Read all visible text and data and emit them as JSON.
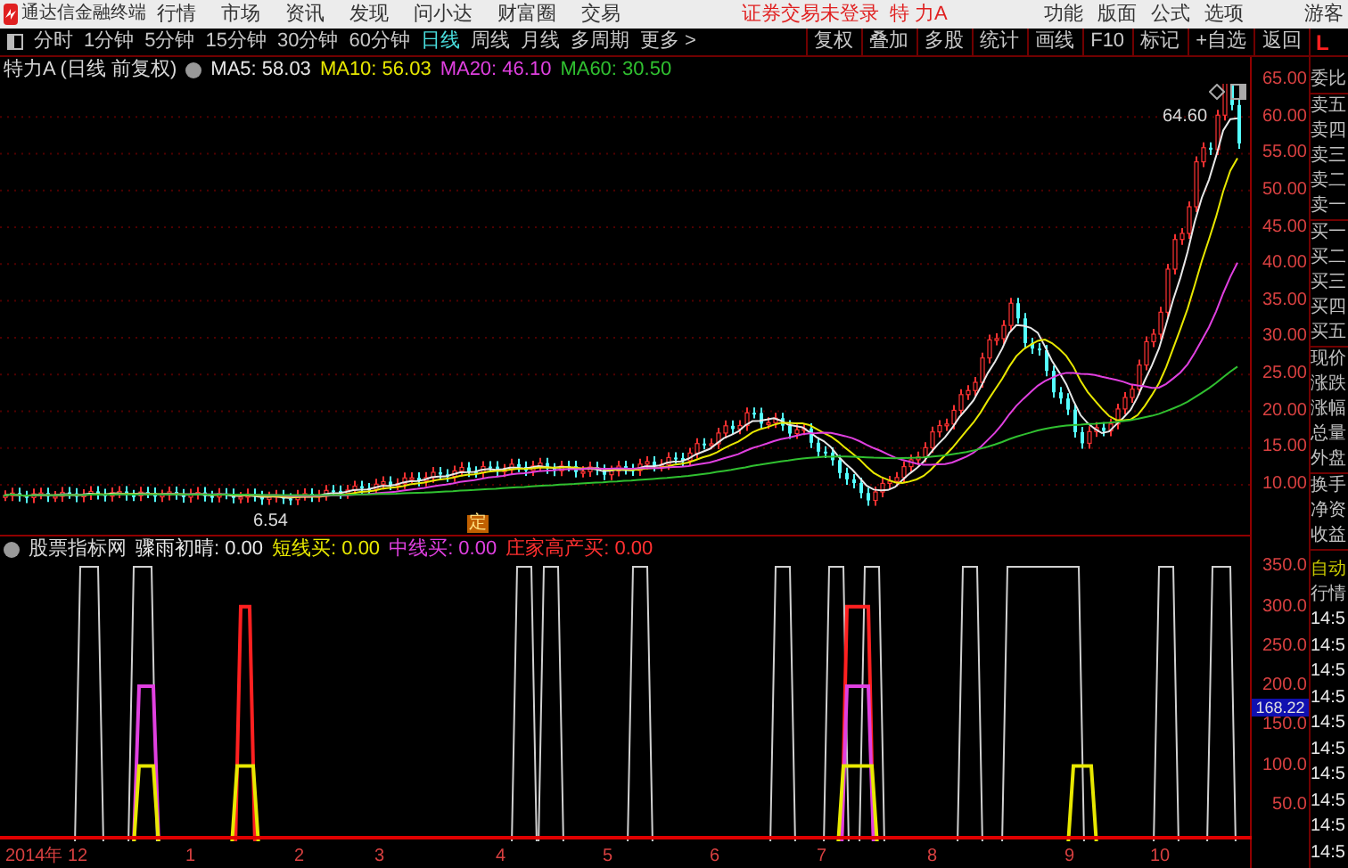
{
  "menu_bar": {
    "app_title": "通达信金融终端",
    "menus": [
      "行情",
      "市场",
      "资讯",
      "发现",
      "问小达",
      "财富圈",
      "交易"
    ],
    "status": "证券交易未登录",
    "stock": "特 力A",
    "actions": [
      "功能",
      "版面",
      "公式",
      "选项"
    ],
    "user": "游客"
  },
  "period_bar": {
    "periods": [
      {
        "label": "分时",
        "selected": false
      },
      {
        "label": "1分钟",
        "selected": false
      },
      {
        "label": "5分钟",
        "selected": false
      },
      {
        "label": "15分钟",
        "selected": false
      },
      {
        "label": "30分钟",
        "selected": false
      },
      {
        "label": "60分钟",
        "selected": false
      },
      {
        "label": "日线",
        "selected": true
      },
      {
        "label": "周线",
        "selected": false
      },
      {
        "label": "月线",
        "selected": false
      },
      {
        "label": "多周期",
        "selected": false
      },
      {
        "label": "更多 >",
        "selected": false
      }
    ],
    "tools": [
      "复权",
      "叠加",
      "多股",
      "统计",
      "画线",
      "F10",
      "标记",
      "+自选",
      "返回"
    ],
    "logo": "L"
  },
  "chart_header": {
    "title": "特力A (日线 前复权)",
    "indicators": [
      {
        "label": "MA5: 58.03",
        "color": "#e8e8e8"
      },
      {
        "label": "MA10: 56.03",
        "color": "#e8e800"
      },
      {
        "label": "MA20: 46.10",
        "color": "#e040e0"
      },
      {
        "label": "MA60: 30.50",
        "color": "#30c030"
      }
    ]
  },
  "price_chart": {
    "axis_labels": [
      "65.00",
      "60.00",
      "55.00",
      "50.00",
      "45.00",
      "40.00",
      "35.00",
      "30.00",
      "25.00",
      "20.00",
      "15.00",
      "10.00"
    ],
    "high_label": "64.60",
    "low_label": "6.54",
    "marker": "定"
  },
  "indicator_header": {
    "title": "股票指标网",
    "values": [
      {
        "label": "骤雨初晴: 0.00",
        "color": "#e8e8e8"
      },
      {
        "label": "短线买: 0.00",
        "color": "#e8e800"
      },
      {
        "label": "中线买: 0.00",
        "color": "#e040e0"
      },
      {
        "label": "庄家高产买: 0.00",
        "color": "#ff3030"
      }
    ]
  },
  "indicator_chart": {
    "axis_labels": [
      "350.0",
      "300.0",
      "250.0",
      "200.0",
      "150.0",
      "100.0",
      "50.0"
    ],
    "cursor_value": "168.22"
  },
  "date_axis": [
    "2014年",
    "12",
    "1",
    "2",
    "3",
    "4",
    "5",
    "6",
    "7",
    "8",
    "9",
    "10"
  ],
  "quote_panel": {
    "groups": [
      [
        "委比"
      ],
      [
        "卖五",
        "卖四",
        "卖三",
        "卖二",
        "卖一"
      ],
      [
        "买一",
        "买二",
        "买三",
        "买四",
        "买五"
      ],
      [
        "现价",
        "涨跌",
        "涨幅",
        "总量",
        "外盘"
      ],
      [
        "换手",
        "净资",
        "收益"
      ]
    ],
    "mode": "自动",
    "title": "行情",
    "times": [
      "14:5",
      "14:5",
      "14:5",
      "14:5",
      "14:5",
      "14:5",
      "14:5",
      "14:5",
      "14:5",
      "14:5"
    ]
  }
}
